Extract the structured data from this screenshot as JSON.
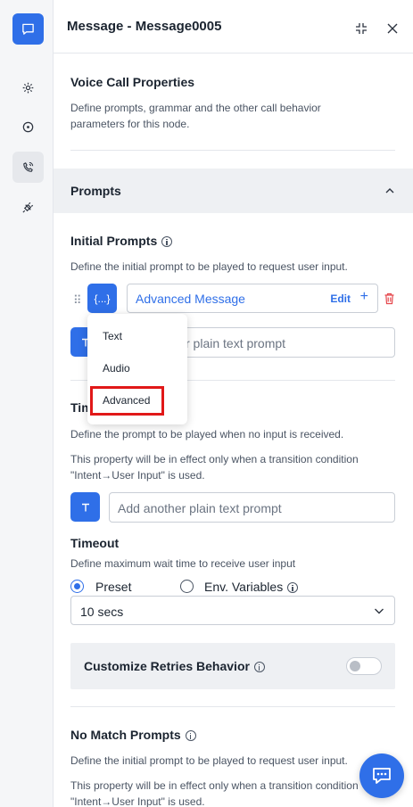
{
  "header": {
    "title": "Message - Message0005"
  },
  "voice_call": {
    "title": "Voice Call Properties",
    "description": "Define prompts, grammar and the other call behavior parameters for this node."
  },
  "prompts_section": {
    "title": "Prompts"
  },
  "initial_prompts": {
    "title": "Initial Prompts",
    "description": "Define the initial prompt to be played to request user input.",
    "type_button_label": "{...}",
    "advanced_value": "Advanced Message",
    "edit_label": "Edit",
    "add_label": "+",
    "plain_text_placeholder": "Add another plain text prompt",
    "plain_text_visible": "r plain text prompt"
  },
  "prompt_type_menu": {
    "items": [
      "Text",
      "Audio",
      "Advanced"
    ],
    "selected": "Advanced"
  },
  "timeout_prompts": {
    "title_visible": "Tim",
    "description": "Define the prompt to be played when no input is received.",
    "note": "This property will be in effect only when a transition condition \"Intent→User Input\" is used.",
    "plain_text_placeholder": "Add another plain text prompt"
  },
  "timeout": {
    "title": "Timeout",
    "description": "Define maximum wait time to receive user input",
    "options": [
      "Preset",
      "Env. Variables"
    ],
    "selected_option": "Preset",
    "value": "10 secs"
  },
  "retries": {
    "label": "Customize Retries Behavior",
    "enabled": false
  },
  "no_match": {
    "title": "No Match Prompts",
    "description": "Define the initial prompt to be played to request user input.",
    "note": "This property will be in effect only when a transition condition \"Intent→User Input\" is used."
  },
  "colors": {
    "accent": "#2f6fe8",
    "highlight": "#e11818",
    "danger": "#e5484d"
  }
}
